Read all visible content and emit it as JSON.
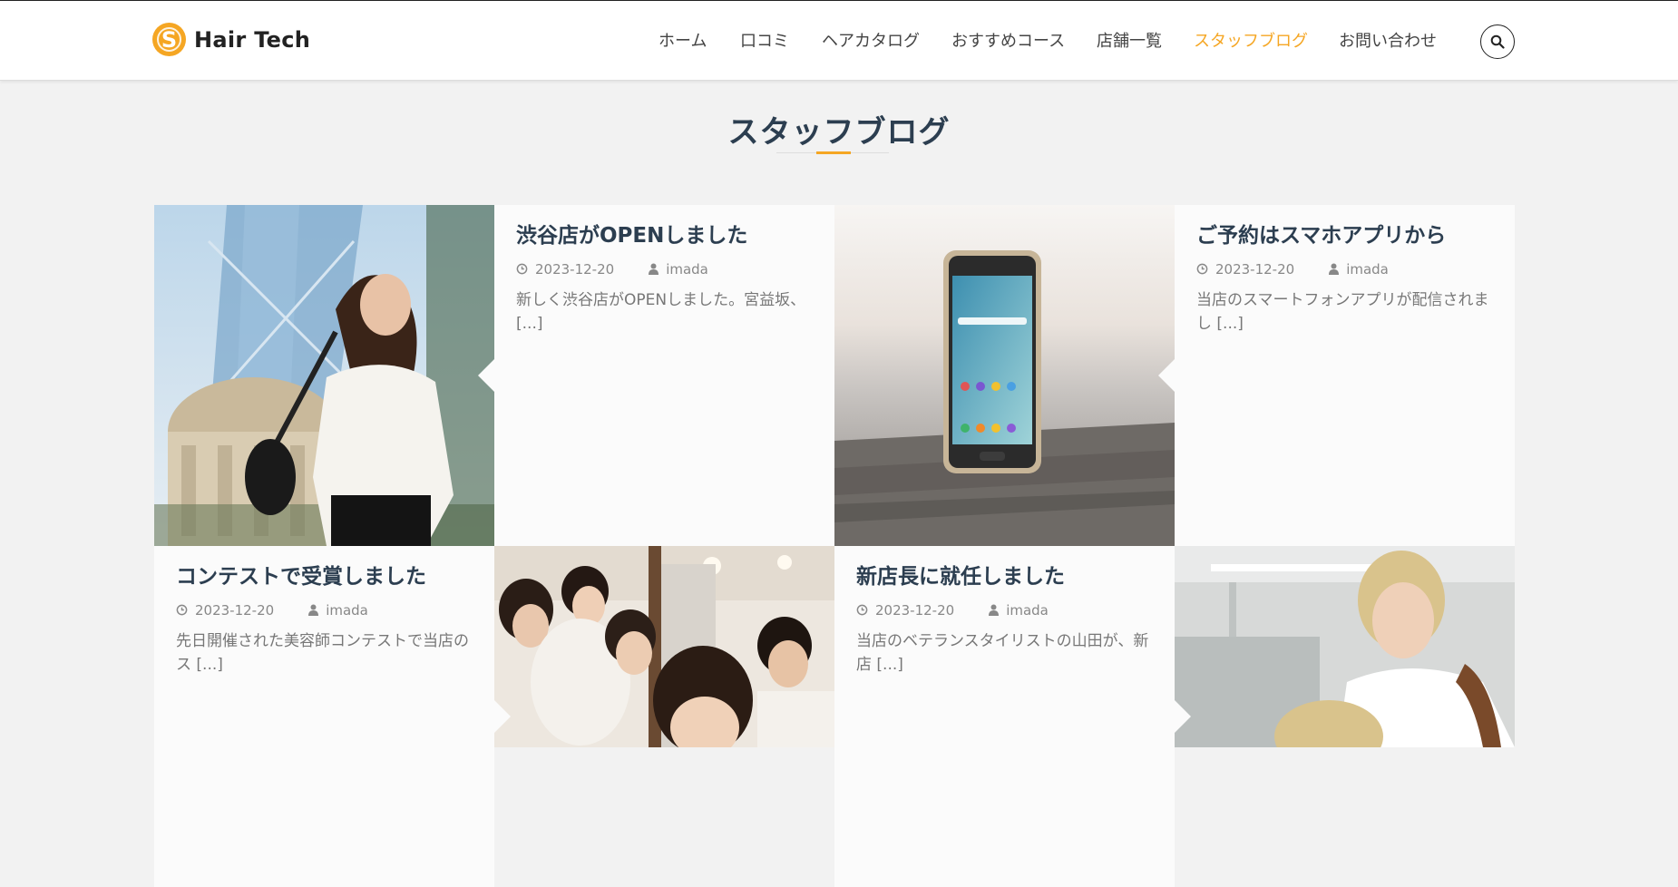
{
  "brand": {
    "name": "Hair Tech",
    "accent_color": "#f5a623",
    "logo_icon": "s-coin-icon"
  },
  "nav": {
    "items": [
      {
        "label": "ホーム"
      },
      {
        "label": "口コミ"
      },
      {
        "label": "ヘアカタログ"
      },
      {
        "label": "おすすめコース"
      },
      {
        "label": "店舗一覧"
      },
      {
        "label": "スタッフブログ",
        "active": true
      },
      {
        "label": "お問い合わせ"
      }
    ],
    "search_icon": "search-icon"
  },
  "page": {
    "title": "スタッフブログ"
  },
  "posts": [
    {
      "title": "渋谷店がOPENしました",
      "date": "2023-12-20",
      "author": "imada",
      "excerpt": "新しく渋谷店がOPENしました。宮益坂、[...]",
      "image": "woman-walking-city-photo"
    },
    {
      "title": "ご予約はスマホアプリから",
      "date": "2023-12-20",
      "author": "imada",
      "excerpt": "当店のスマートフォンアプリが配信されまし [...]",
      "image": "smartphone-on-table-photo"
    },
    {
      "title": "コンテストで受賞しました",
      "date": "2023-12-20",
      "author": "imada",
      "excerpt": "先日開催された美容師コンテストで当店のス [...]",
      "image": "salon-staff-group-photo"
    },
    {
      "title": "新店長に就任しました",
      "date": "2023-12-20",
      "author": "imada",
      "excerpt": "当店のベテランスタイリストの山田が、新店 [...]",
      "image": "stylist-cutting-hair-photo"
    }
  ]
}
